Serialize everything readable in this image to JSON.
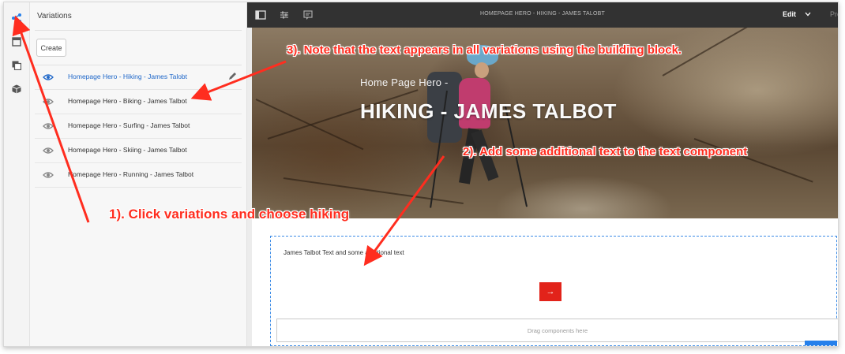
{
  "panel": {
    "title": "Variations",
    "create_label": "Create",
    "items": [
      {
        "label": "Homepage Hero - Hiking - James Talobt",
        "active": true
      },
      {
        "label": "Homepage Hero - Biking - James Talbot",
        "active": false
      },
      {
        "label": "Homepage Hero - Surfing - James Talbot",
        "active": false
      },
      {
        "label": "Homepage Hero - Skiing - James Talbot",
        "active": false
      },
      {
        "label": "Homepage Hero - Running - James Talbot",
        "active": false
      }
    ]
  },
  "rail": {
    "icons": [
      "share-variations-icon",
      "page-icon",
      "copy-icon",
      "package-icon"
    ]
  },
  "toolbar": {
    "title": "HOMEPAGE HERO - HIKING - JAMES TALOBT",
    "mode_label": "Edit",
    "preview_label": "Pre",
    "icons": [
      "toggle-side-panel-icon",
      "page-properties-icon",
      "annotate-icon",
      "chevron-down-icon"
    ]
  },
  "hero": {
    "subtitle": "Home Page Hero -",
    "title": "HIKING - JAMES TALBOT"
  },
  "content": {
    "text": "James Talbot Text and some additional text",
    "button_icon": "→",
    "dropzone_label": "Drag components here"
  },
  "annotations": {
    "step1": "1). Click variations and choose hiking",
    "step2": "2). Add some additional text to the text component",
    "step3": "3). Note that the text appears in all variations using the building block."
  },
  "colors": {
    "accent_red": "#e2231a",
    "annotation_red": "#ff2d1f",
    "active_blue": "#2068c9",
    "toolbar_bg": "#323232",
    "selection_blue": "#3b8be6"
  }
}
